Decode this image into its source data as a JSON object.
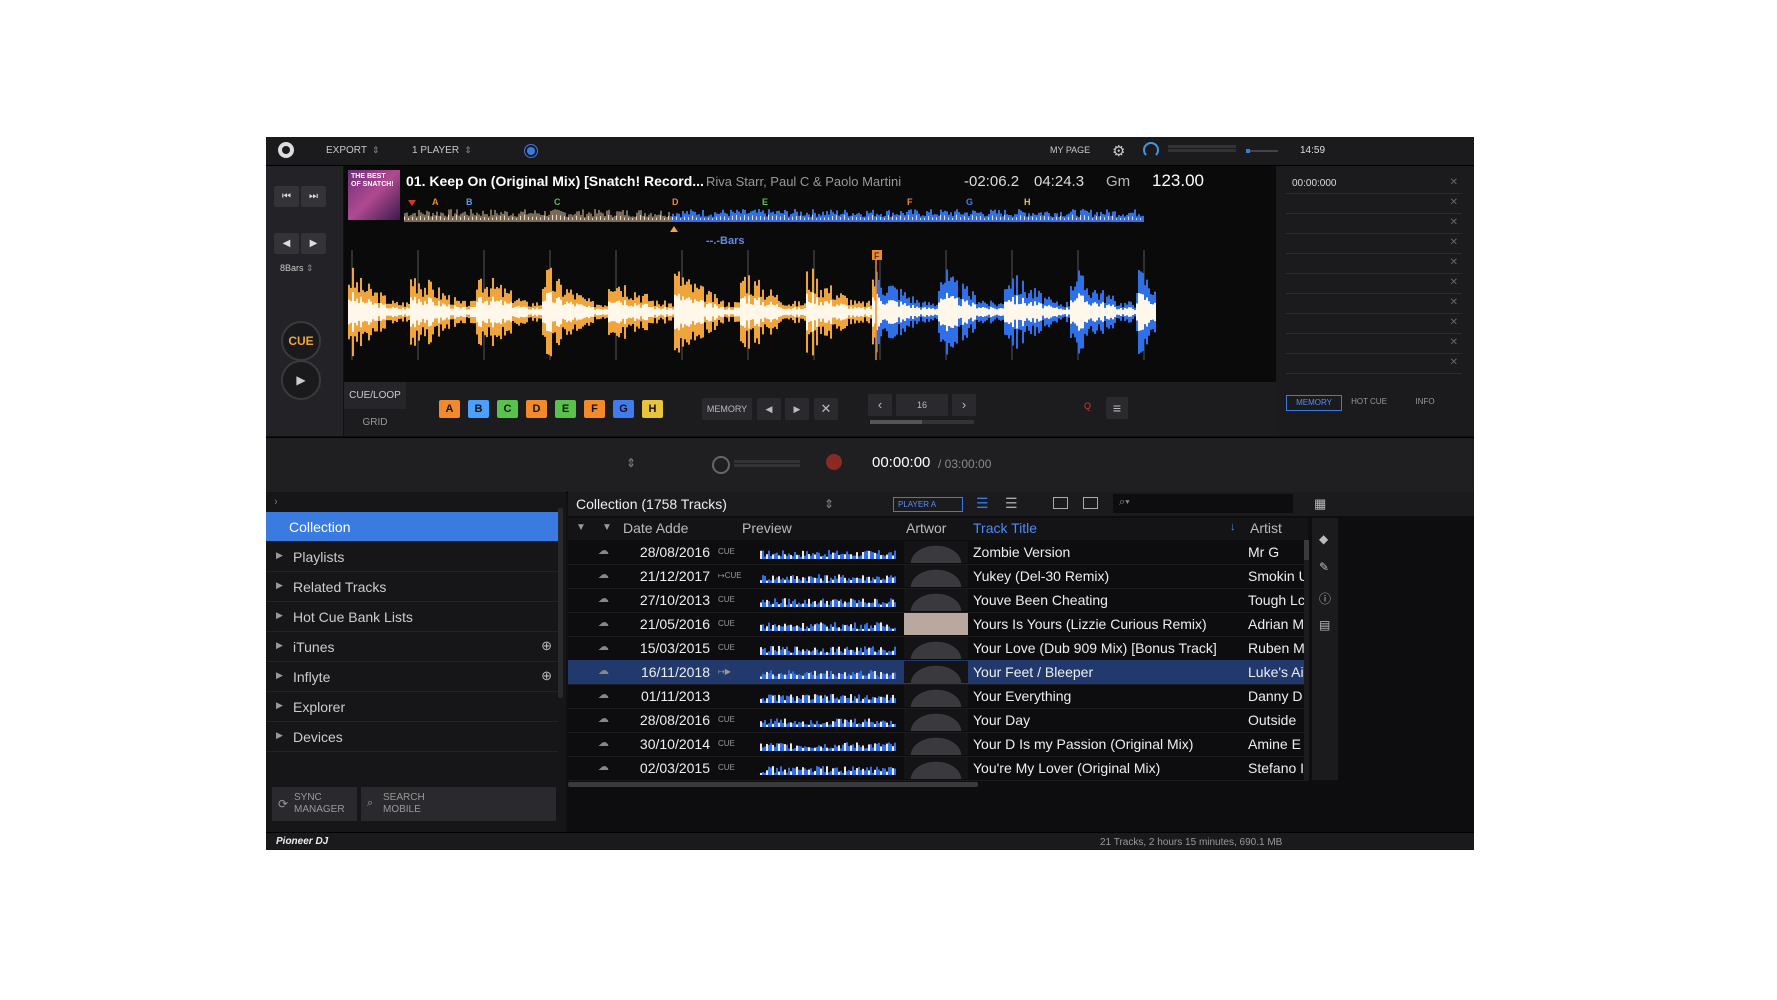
{
  "topbar": {
    "export_label": "EXPORT",
    "player_label": "1 PLAYER",
    "mypage_label": "MY PAGE",
    "clock": "14:59"
  },
  "deck": {
    "track_title": "01. Keep On (Original Mix) [Snatch! Record...",
    "artist": "Riva Starr, Paul C & Paolo Martini",
    "remaining_time": "-02:06.2",
    "total_time": "04:24.3",
    "key": "Gm",
    "bpm": "123.00",
    "bars_label": "--.-Bars",
    "beat_jump": "8Bars",
    "cue_label": "CUE",
    "artwork_text": "THE BEST OF SNATCH!",
    "overview_cues": [
      "A",
      "B",
      "C",
      "D",
      "E",
      "F",
      "G",
      "H"
    ],
    "zoom_cue": "F"
  },
  "cue_panel": {
    "cueloop_label": "CUE/LOOP",
    "grid_label": "GRID",
    "hotcues": [
      {
        "label": "A",
        "color": "#f28a2c"
      },
      {
        "label": "B",
        "color": "#4aa0ff"
      },
      {
        "label": "C",
        "color": "#59c24a"
      },
      {
        "label": "D",
        "color": "#f28a2c"
      },
      {
        "label": "E",
        "color": "#59c24a"
      },
      {
        "label": "F",
        "color": "#f28a2c"
      },
      {
        "label": "G",
        "color": "#3f7cf0"
      },
      {
        "label": "H",
        "color": "#e8c43a"
      }
    ],
    "memory_label": "MEMORY",
    "loop_value": "16",
    "q_label": "Q"
  },
  "memory_panel": {
    "first_time": "00:00:000",
    "tabs": [
      "MEMORY",
      "HOT CUE",
      "INFO"
    ]
  },
  "recorder": {
    "time": "00:00:00",
    "total": "/ 03:00:00"
  },
  "sidebar": {
    "items": [
      {
        "label": "Collection",
        "active": true,
        "plus": false
      },
      {
        "label": "Playlists",
        "active": false,
        "plus": false
      },
      {
        "label": "Related Tracks",
        "active": false,
        "plus": false
      },
      {
        "label": "Hot Cue Bank Lists",
        "active": false,
        "plus": false
      },
      {
        "label": "iTunes",
        "active": false,
        "plus": true
      },
      {
        "label": "Inflyte",
        "active": false,
        "plus": true
      },
      {
        "label": "Explorer",
        "active": false,
        "plus": false
      },
      {
        "label": "Devices",
        "active": false,
        "plus": false
      }
    ],
    "sync_manager_label": [
      "SYNC",
      "MANAGER"
    ],
    "search_mobile_label": [
      "SEARCH",
      "MOBILE"
    ]
  },
  "browser": {
    "header": "Collection (1758 Tracks)",
    "player_badge": "PLAYER A",
    "columns": {
      "date": "Date Adde",
      "preview": "Preview",
      "artwork": "Artwor",
      "title": "Track Title",
      "artist": "Artist"
    },
    "rows": [
      {
        "date": "28/08/2016",
        "cue": "CUE",
        "title": "Zombie Version",
        "artist": "Mr G",
        "selected": false
      },
      {
        "date": "21/12/2017",
        "cue": "↦CUE",
        "title": "Yukey (Del-30 Remix)",
        "artist": "Smokin U",
        "selected": false
      },
      {
        "date": "27/10/2013",
        "cue": "CUE",
        "title": "Youve Been Cheating",
        "artist": "Tough Lc",
        "selected": false
      },
      {
        "date": "21/05/2016",
        "cue": "CUE",
        "title": "Yours Is Yours (Lizzie Curious Remix)",
        "artist": "Adrian M",
        "selected": false
      },
      {
        "date": "15/03/2015",
        "cue": "CUE",
        "title": "Your Love (Dub 909 Mix) [Bonus Track]",
        "artist": "Ruben M",
        "selected": false
      },
      {
        "date": "16/11/2018",
        "cue": "↦▶",
        "title": "Your Feet / Bleeper",
        "artist": "Luke's Ai",
        "selected": true
      },
      {
        "date": "01/11/2013",
        "cue": "",
        "title": "Your Everything",
        "artist": "Danny D",
        "selected": false
      },
      {
        "date": "28/08/2016",
        "cue": "CUE",
        "title": "Your Day",
        "artist": "Outside",
        "selected": false
      },
      {
        "date": "30/10/2014",
        "cue": "CUE",
        "title": "Your D Is my Passion (Original Mix)",
        "artist": "Amine E",
        "selected": false
      },
      {
        "date": "02/03/2015",
        "cue": "CUE",
        "title": "You're My Lover (Original Mix)",
        "artist": "Stefano I",
        "selected": false
      }
    ]
  },
  "status": {
    "logo": "Pioneer DJ",
    "summary": "21 Tracks, 2 hours 15 minutes, 690.1 MB"
  },
  "colors": {
    "accent_blue": "#3a7be0",
    "wave_orange": "#f0a53c",
    "wave_blue": "#2f6fe8"
  }
}
